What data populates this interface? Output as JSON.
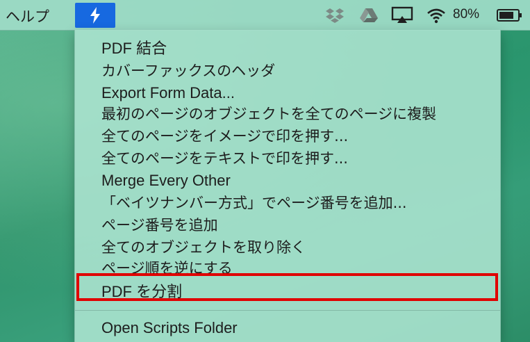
{
  "menubar": {
    "help_label": "ヘルプ",
    "battery_percent": "80%",
    "icons": [
      "script-bolt-icon",
      "dropbox-icon",
      "google-drive-icon",
      "airplay-icon",
      "wifi-icon",
      "battery-icon"
    ]
  },
  "menu": {
    "items": [
      "PDF 結合",
      "カバーファックスのヘッダ",
      "Export Form Data...",
      "最初のページのオブジェクトを全てのページに複製",
      "全てのページをイメージで印を押す...",
      "全てのページをテキストで印を押す...",
      "Merge Every Other",
      "「ベイツナンバー方式」でページ番号を追加...",
      "ページ番号を追加",
      "全てのオブジェクトを取り除く",
      "ページ順を逆にする",
      "PDF を分割"
    ],
    "footer_item": "Open Scripts Folder"
  },
  "colors": {
    "accent": "#1769e0",
    "highlight_border": "#e00000",
    "menu_bg": "#aae2ce"
  }
}
